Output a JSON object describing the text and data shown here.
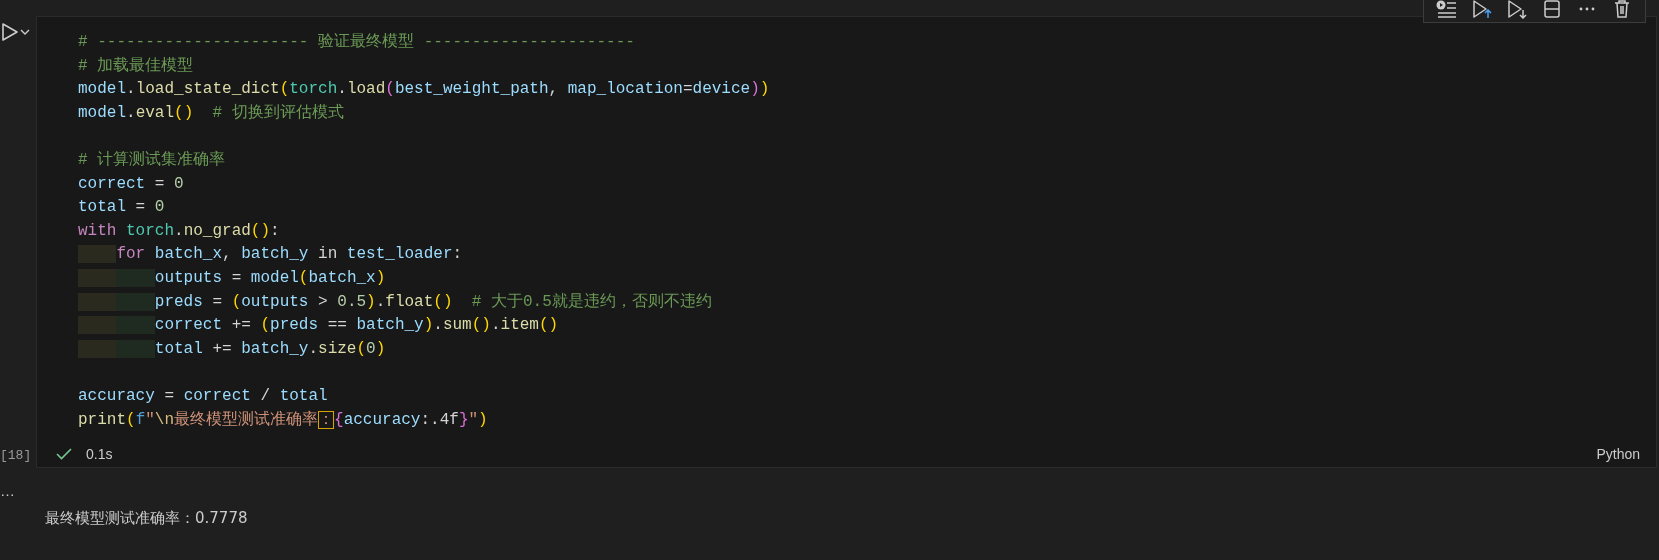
{
  "cell": {
    "execution_count": "[18]",
    "lines": [
      {
        "kind": "code",
        "tokens": [
          {
            "text": "# ---------------------- 验证最终模型 ----------------------",
            "kind": "cm"
          }
        ]
      },
      {
        "kind": "code",
        "tokens": [
          {
            "text": "# 加载最佳模型",
            "kind": "cm"
          }
        ]
      },
      {
        "kind": "code",
        "tokens": [
          {
            "text": "model",
            "kind": "var"
          },
          {
            "text": ".",
            "kind": "op"
          },
          {
            "text": "load_state_dict",
            "kind": "fn"
          },
          {
            "text": "(",
            "kind": "b1"
          },
          {
            "text": "torch",
            "kind": "cls"
          },
          {
            "text": ".",
            "kind": "op"
          },
          {
            "text": "load",
            "kind": "fn"
          },
          {
            "text": "(",
            "kind": "b2"
          },
          {
            "text": "best_weight_path",
            "kind": "var"
          },
          {
            "text": ", ",
            "kind": "op"
          },
          {
            "text": "map_location",
            "kind": "var"
          },
          {
            "text": "=",
            "kind": "op"
          },
          {
            "text": "device",
            "kind": "var"
          },
          {
            "text": ")",
            "kind": "b2"
          },
          {
            "text": ")",
            "kind": "b1"
          }
        ]
      },
      {
        "kind": "code",
        "tokens": [
          {
            "text": "model",
            "kind": "var"
          },
          {
            "text": ".",
            "kind": "op"
          },
          {
            "text": "eval",
            "kind": "fn"
          },
          {
            "text": "()",
            "kind": "b1"
          },
          {
            "text": "  # 切换到评估模式",
            "kind": "cm"
          }
        ]
      },
      {
        "kind": "blank"
      },
      {
        "kind": "code",
        "tokens": [
          {
            "text": "# 计算测试集准确率",
            "kind": "cm"
          }
        ]
      },
      {
        "kind": "code",
        "tokens": [
          {
            "text": "correct",
            "kind": "var"
          },
          {
            "text": " = ",
            "kind": "op"
          },
          {
            "text": "0",
            "kind": "num"
          }
        ]
      },
      {
        "kind": "code",
        "tokens": [
          {
            "text": "total",
            "kind": "var"
          },
          {
            "text": " = ",
            "kind": "op"
          },
          {
            "text": "0",
            "kind": "num"
          }
        ]
      },
      {
        "kind": "code",
        "tokens": [
          {
            "text": "with ",
            "kind": "kw"
          },
          {
            "text": "torch",
            "kind": "cls"
          },
          {
            "text": ".",
            "kind": "op"
          },
          {
            "text": "no_grad",
            "kind": "fn"
          },
          {
            "text": "()",
            "kind": "b1"
          },
          {
            "text": ":",
            "kind": "op"
          }
        ]
      },
      {
        "kind": "code",
        "tokens": [
          {
            "text": "    for ",
            "kind": "kw"
          },
          {
            "text": "batch_x",
            "kind": "var"
          },
          {
            "text": ", ",
            "kind": "op"
          },
          {
            "text": "batch_y",
            "kind": "var"
          },
          {
            "text": " in ",
            "kind": "kw2"
          },
          {
            "text": "test_loader",
            "kind": "var"
          },
          {
            "text": ":",
            "kind": "op"
          }
        ]
      },
      {
        "kind": "code",
        "tokens": [
          {
            "text": "        outputs",
            "kind": "var"
          },
          {
            "text": " = ",
            "kind": "op"
          },
          {
            "text": "model",
            "kind": "var"
          },
          {
            "text": "(",
            "kind": "b1"
          },
          {
            "text": "batch_x",
            "kind": "var"
          },
          {
            "text": ")",
            "kind": "b1"
          }
        ]
      },
      {
        "kind": "code",
        "tokens": [
          {
            "text": "        preds",
            "kind": "var"
          },
          {
            "text": " = ",
            "kind": "op"
          },
          {
            "text": "(",
            "kind": "b1"
          },
          {
            "text": "outputs",
            "kind": "var"
          },
          {
            "text": " > ",
            "kind": "op"
          },
          {
            "text": "0.5",
            "kind": "num"
          },
          {
            "text": ")",
            "kind": "b1"
          },
          {
            "text": ".",
            "kind": "op"
          },
          {
            "text": "float",
            "kind": "fn"
          },
          {
            "text": "()",
            "kind": "b1"
          },
          {
            "text": "  # 大于0.5就是违约，否则不违约",
            "kind": "cm"
          }
        ]
      },
      {
        "kind": "code",
        "tokens": [
          {
            "text": "        correct",
            "kind": "var"
          },
          {
            "text": " += ",
            "kind": "op"
          },
          {
            "text": "(",
            "kind": "b1"
          },
          {
            "text": "preds",
            "kind": "var"
          },
          {
            "text": " == ",
            "kind": "op"
          },
          {
            "text": "batch_y",
            "kind": "var"
          },
          {
            "text": ")",
            "kind": "b1"
          },
          {
            "text": ".",
            "kind": "op"
          },
          {
            "text": "sum",
            "kind": "fn"
          },
          {
            "text": "()",
            "kind": "b1"
          },
          {
            "text": ".",
            "kind": "op"
          },
          {
            "text": "item",
            "kind": "fn"
          },
          {
            "text": "()",
            "kind": "b1"
          }
        ]
      },
      {
        "kind": "code",
        "tokens": [
          {
            "text": "        total",
            "kind": "var"
          },
          {
            "text": " += ",
            "kind": "op"
          },
          {
            "text": "batch_y",
            "kind": "var"
          },
          {
            "text": ".",
            "kind": "op"
          },
          {
            "text": "size",
            "kind": "fn"
          },
          {
            "text": "(",
            "kind": "b1"
          },
          {
            "text": "0",
            "kind": "num"
          },
          {
            "text": ")",
            "kind": "b1"
          }
        ]
      },
      {
        "kind": "blank"
      },
      {
        "kind": "code",
        "tokens": [
          {
            "text": "accuracy",
            "kind": "var"
          },
          {
            "text": " = ",
            "kind": "op"
          },
          {
            "text": "correct",
            "kind": "var"
          },
          {
            "text": " / ",
            "kind": "op"
          },
          {
            "text": "total",
            "kind": "var"
          }
        ]
      },
      {
        "kind": "code",
        "tokens": [
          {
            "text": "print",
            "kind": "fn"
          },
          {
            "text": "(",
            "kind": "b1"
          },
          {
            "text": "f",
            "kind": "pre"
          },
          {
            "text": "\"",
            "kind": "str"
          },
          {
            "text": "\\n",
            "kind": "esc"
          },
          {
            "text": "最终模型测试准确率",
            "kind": "str"
          },
          {
            "text": "：",
            "kind": "boxed"
          },
          {
            "text": "{",
            "kind": "b2"
          },
          {
            "text": "accuracy",
            "kind": "var"
          },
          {
            "text": ":.4f",
            "kind": "op"
          },
          {
            "text": "}",
            "kind": "b2"
          },
          {
            "text": "\"",
            "kind": "str"
          },
          {
            "text": ")",
            "kind": "b1"
          }
        ]
      }
    ],
    "status": {
      "succeeded": true,
      "duration": "0.1s",
      "language": "Python"
    }
  },
  "output": {
    "ellipsis": "…",
    "text": "最终模型测试准确率：0.7778"
  }
}
